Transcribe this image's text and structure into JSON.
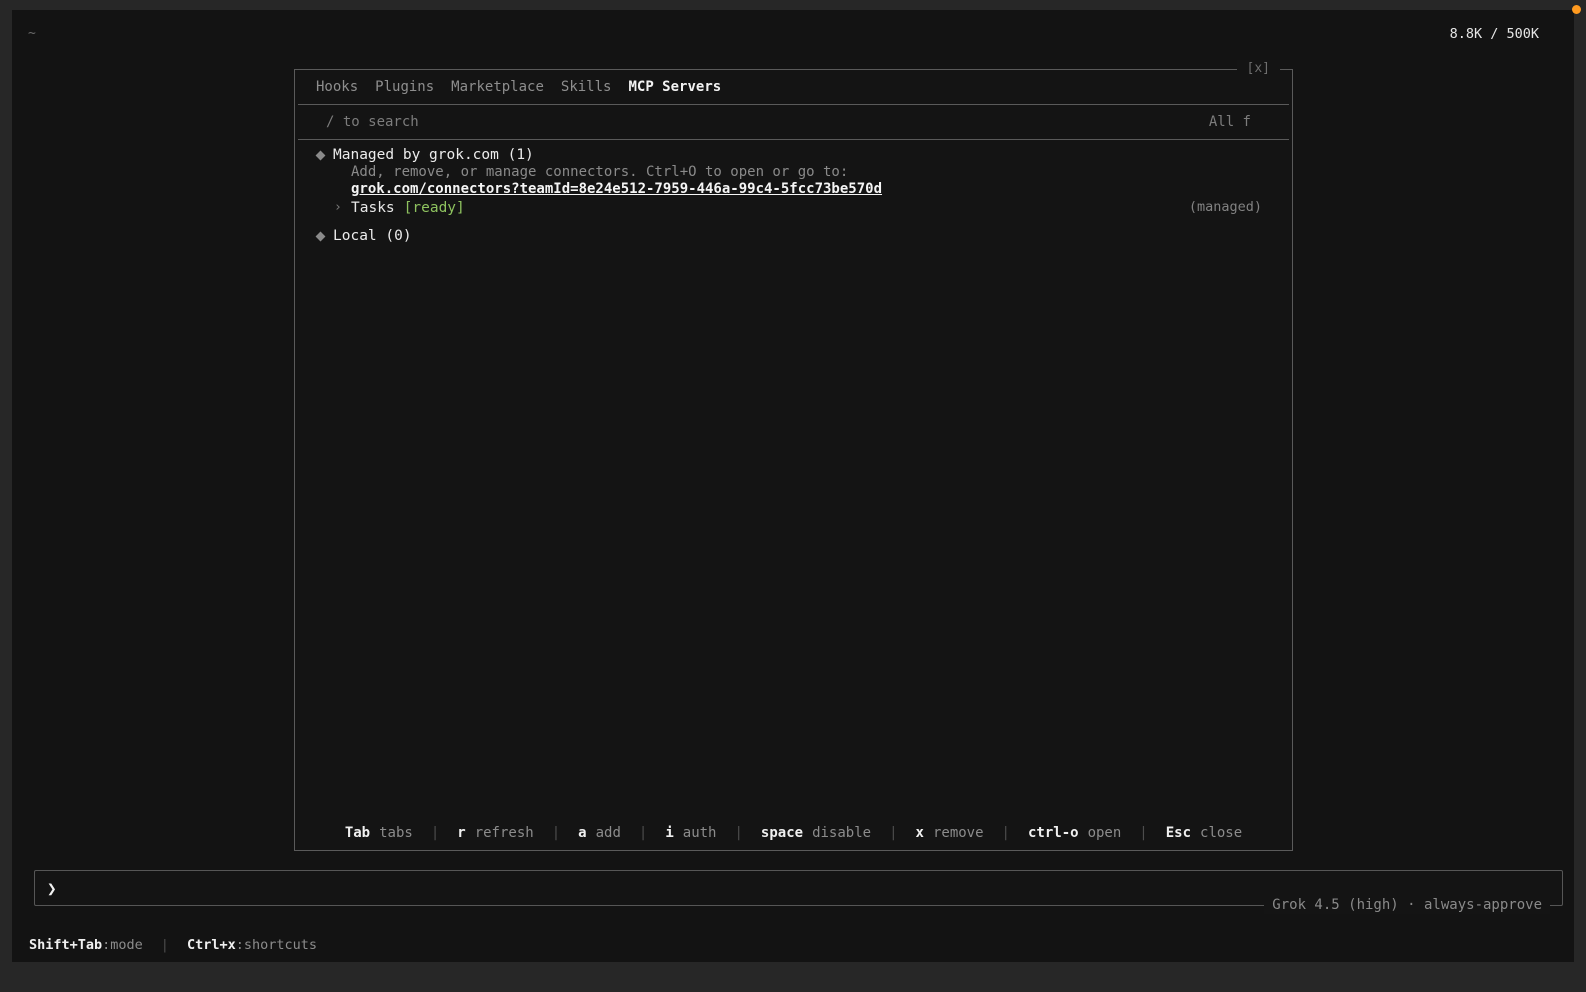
{
  "top": {
    "path": "~",
    "token_counter": "8.8K / 500K"
  },
  "modal": {
    "close_label": "[x]",
    "tabs": [
      {
        "label": "Hooks",
        "active": false
      },
      {
        "label": "Plugins",
        "active": false
      },
      {
        "label": "Marketplace",
        "active": false
      },
      {
        "label": "Skills",
        "active": false
      },
      {
        "label": "MCP Servers",
        "active": true
      }
    ],
    "search_hint": "/ to search",
    "filter_label": "All f",
    "groups": [
      {
        "title": "Managed by grok.com (1)",
        "description": "Add, remove, or manage connectors. Ctrl+O to open or go to:",
        "link": "grok.com/connectors?teamId=8e24e512-7959-446a-99c4-5fcc73be570d",
        "servers": [
          {
            "name": "Tasks",
            "status": "[ready]",
            "tag": "(managed)"
          }
        ]
      },
      {
        "title": "Local (0)"
      }
    ],
    "footer_hints": [
      {
        "key": "Tab",
        "action": "tabs"
      },
      {
        "key": "r",
        "action": "refresh"
      },
      {
        "key": "a",
        "action": "add"
      },
      {
        "key": "i",
        "action": "auth"
      },
      {
        "key": "space",
        "action": "disable"
      },
      {
        "key": "x",
        "action": "remove"
      },
      {
        "key": "ctrl-o",
        "action": "open"
      },
      {
        "key": "Esc",
        "action": "close"
      }
    ]
  },
  "prompt": {
    "caret": "❯",
    "value": "",
    "model_info": "Grok 4.5 (high) · always-approve"
  },
  "statusbar": {
    "items": [
      {
        "key": "Shift+Tab",
        "action": ":mode"
      },
      {
        "key": "Ctrl+x",
        "action": ":shortcuts"
      }
    ]
  },
  "colors": {
    "background": "#131313",
    "outer_frame": "#272727",
    "ready_status": "#8ec25f",
    "indicator_dot": "#ff9a1f"
  }
}
